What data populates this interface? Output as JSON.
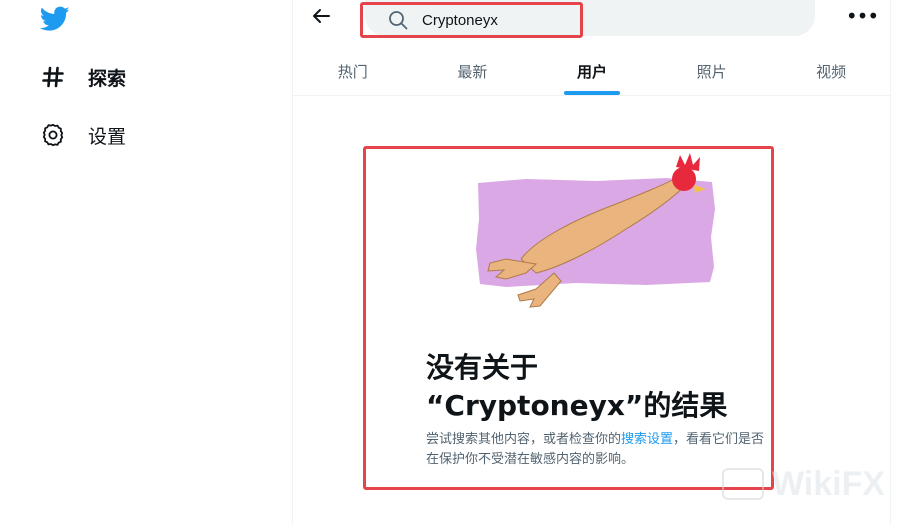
{
  "sidebar": {
    "items": [
      {
        "label": "探索",
        "icon": "hashtag-icon"
      },
      {
        "label": "设置",
        "icon": "gear-icon"
      }
    ]
  },
  "header": {
    "search_value": "Cryptoneyx",
    "more_label": "•••"
  },
  "tabs": [
    {
      "label": "热门"
    },
    {
      "label": "最新"
    },
    {
      "label": "用户",
      "active": true
    },
    {
      "label": "照片"
    },
    {
      "label": "视频"
    }
  ],
  "empty_state": {
    "title_line1": "没有关于",
    "title_line2": "“Cryptoneyx”的结果",
    "desc_before": "尝试搜索其他内容，或者检查你的",
    "desc_link": "搜索设置",
    "desc_after": "，看看它们是否在保护你不受潜在敏感内容的影响。"
  },
  "watermark": {
    "text": "WikiFX"
  },
  "colors": {
    "accent": "#1d9bf0",
    "highlight_border": "#e5454a",
    "muted_text": "#536471",
    "illustration_bg": "#dba8e6",
    "chicken_body": "#eab47e",
    "chicken_comb": "#e8283c"
  }
}
